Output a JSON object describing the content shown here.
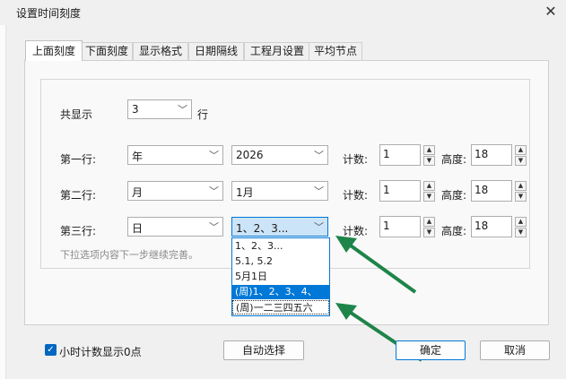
{
  "window": {
    "title": "设置时间刻度",
    "close_glyph": "✕"
  },
  "tabs": [
    {
      "label": "上面刻度"
    },
    {
      "label": "下面刻度"
    },
    {
      "label": "显示格式"
    },
    {
      "label": "日期隔线"
    },
    {
      "label": "工程月设置"
    },
    {
      "label": "平均节点"
    }
  ],
  "display": {
    "label": "共显示",
    "value": "3",
    "unit": "行"
  },
  "rows": [
    {
      "label": "第一行:",
      "unit": "年",
      "format": "2026",
      "count_label": "计数:",
      "count": "1",
      "height_label": "高度:",
      "height": "18"
    },
    {
      "label": "第二行:",
      "unit": "月",
      "format": "1月",
      "count_label": "计数:",
      "count": "1",
      "height_label": "高度:",
      "height": "18"
    },
    {
      "label": "第三行:",
      "unit": "日",
      "format": "1、2、3...",
      "count_label": "计数:",
      "count": "1",
      "height_label": "高度:",
      "height": "18"
    }
  ],
  "hint": "下拉选项内容下一步继续完善。",
  "dropdown_options": [
    "1、2、3...",
    "5.1, 5.2",
    "5月1日",
    "(周)1、2、3、4、",
    "(周)一二三四五六"
  ],
  "footer": {
    "checkbox_label": "小时计数显示0点",
    "checkbox_checked": true,
    "auto_label": "自动选择",
    "ok_label": "确定",
    "cancel_label": "取消"
  },
  "colors": {
    "accent": "#0078d7",
    "arrow": "#1e8449"
  }
}
